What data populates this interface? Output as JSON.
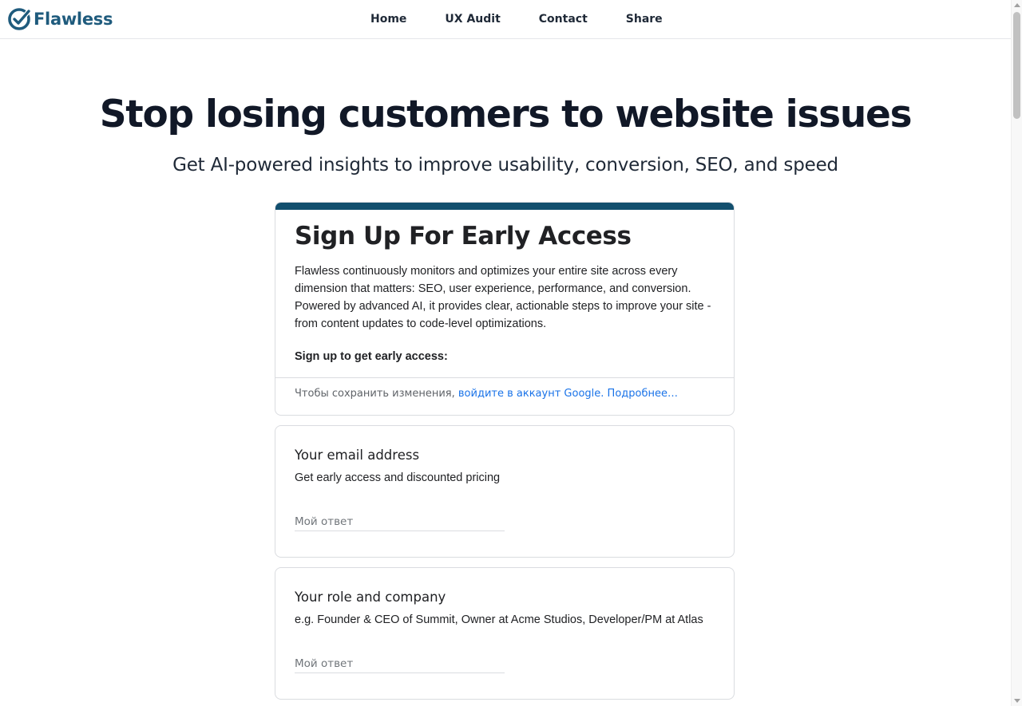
{
  "brand": {
    "name": "Flawless",
    "logo_icon": "checkmark-circle-icon",
    "color": "#1f5b7d"
  },
  "nav": {
    "items": [
      {
        "label": "Home"
      },
      {
        "label": "UX Audit"
      },
      {
        "label": "Contact"
      },
      {
        "label": "Share"
      }
    ]
  },
  "hero": {
    "title": "Stop losing customers to website issues",
    "subtitle": "Get AI-powered insights to improve usability, conversion, SEO, and speed"
  },
  "form": {
    "accent_color": "#124f6e",
    "title": "Sign Up For Early Access",
    "description": "Flawless continuously monitors and optimizes your entire site across every dimension that matters: SEO, user experience, performance, and conversion. Powered by advanced AI, it provides clear, actionable steps to improve your site - from content updates to code-level optimizations.",
    "cta_text": "Sign up to get early access:",
    "signin_prefix": "Чтобы сохранить изменения, ",
    "signin_link": "войдите в аккаунт Google.",
    "learn_more": "Подробнее…",
    "questions": [
      {
        "title": "Your email address",
        "help": "Get early access and discounted pricing",
        "placeholder": "Мой ответ",
        "value": ""
      },
      {
        "title": "Your role and company",
        "help": "e.g. Founder & CEO of Summit, Owner at Acme Studios, Developer/PM at Atlas",
        "placeholder": "Мой ответ",
        "value": ""
      }
    ]
  }
}
